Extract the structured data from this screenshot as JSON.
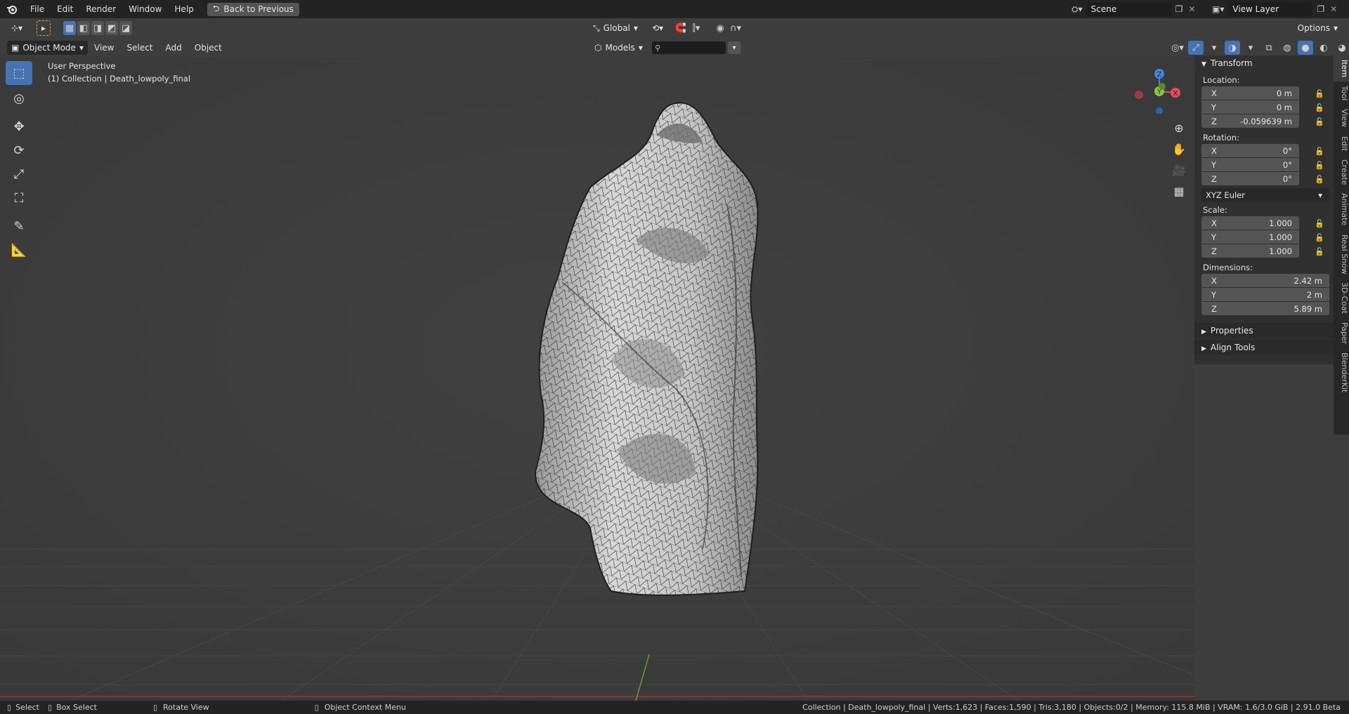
{
  "topbar": {
    "menus": [
      "File",
      "Edit",
      "Render",
      "Window",
      "Help"
    ],
    "back_button": "Back to Previous",
    "scene": "Scene",
    "view_layer": "View Layer"
  },
  "header": {
    "orientation": "Global",
    "options": "Options",
    "mode": "Object Mode",
    "view_menus": [
      "View",
      "Select",
      "Add",
      "Object"
    ],
    "collection_filter": "Models",
    "search_placeholder": ""
  },
  "viewport": {
    "perspective": "User Perspective",
    "collection_info": "(1) Collection | Death_lowpoly_final",
    "gizmo": {
      "x": "X",
      "y": "Y",
      "z": "Z"
    }
  },
  "panel": {
    "transform_title": "Transform",
    "location_label": "Location:",
    "location": [
      {
        "axis": "X",
        "value": "0 m"
      },
      {
        "axis": "Y",
        "value": "0 m"
      },
      {
        "axis": "Z",
        "value": "-0.059639 m"
      }
    ],
    "rotation_label": "Rotation:",
    "rotation": [
      {
        "axis": "X",
        "value": "0°"
      },
      {
        "axis": "Y",
        "value": "0°"
      },
      {
        "axis": "Z",
        "value": "0°"
      }
    ],
    "rotation_mode": "XYZ Euler",
    "scale_label": "Scale:",
    "scale": [
      {
        "axis": "X",
        "value": "1.000"
      },
      {
        "axis": "Y",
        "value": "1.000"
      },
      {
        "axis": "Z",
        "value": "1.000"
      }
    ],
    "dimensions_label": "Dimensions:",
    "dimensions": [
      {
        "axis": "X",
        "value": "2.42 m"
      },
      {
        "axis": "Y",
        "value": "2 m"
      },
      {
        "axis": "Z",
        "value": "5.89 m"
      }
    ],
    "properties_title": "Properties",
    "align_tools_title": "Align Tools"
  },
  "side_tabs": [
    "Item",
    "Tool",
    "View",
    "Edit",
    "Create",
    "Animate",
    "Real Snow",
    "3D-Coat",
    "Paper",
    "BlenderKit"
  ],
  "statusbar": {
    "select": "Select",
    "box_select": "Box Select",
    "rotate_view": "Rotate View",
    "context_menu": "Object Context Menu",
    "stats": "Collection | Death_lowpoly_final | Verts:1,623 | Faces:1,590 | Tris:3,180 | Objects:0/2 | Memory: 115.8 MiB | VRAM: 1.6/3.0 GiB | 2.91.0 Beta"
  },
  "colors": {
    "accent": "#4772b3",
    "x_axis": "#e14e5f",
    "y_axis": "#8bc43f",
    "z_axis": "#3f88e1"
  }
}
